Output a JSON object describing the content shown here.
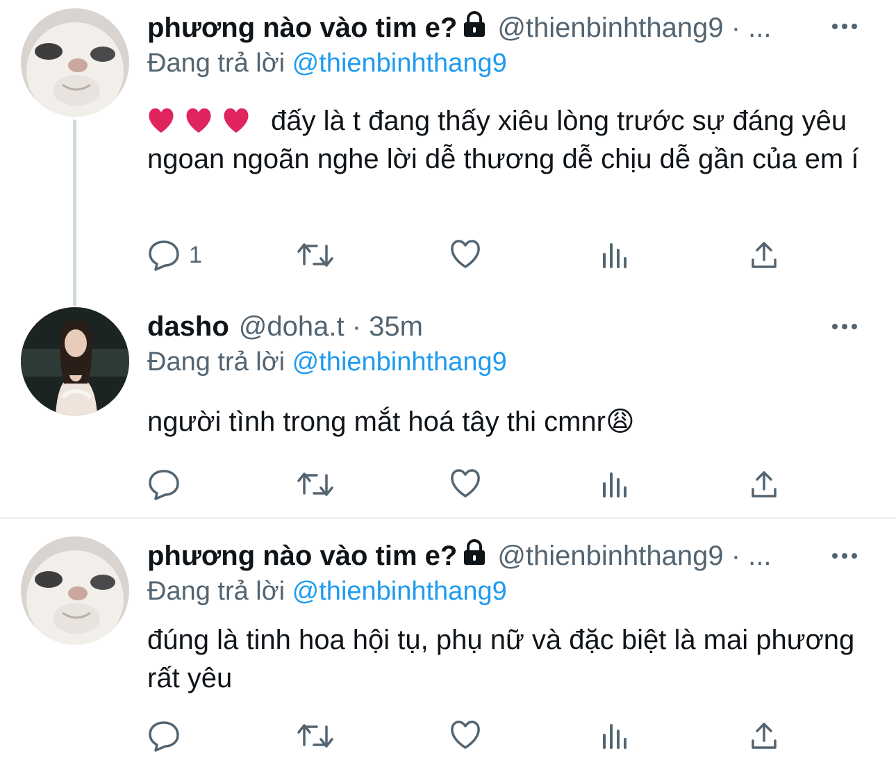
{
  "tweets": [
    {
      "name": "phương nào vào tim e?",
      "handle": "@thienbinhthang9 · ...",
      "replying_prefix": "Đang trả lời",
      "replying_to": "@thienbinhthang9",
      "text": "đấy là t đang thấy xiêu lòng trước sự đáng yêu ngoan ngoãn nghe lời dễ thương dễ chịu dễ gần của em í",
      "emoji_prefix": "❤️ ❤️ ❤️",
      "reply_count": "1",
      "locked": true
    },
    {
      "name": "dasho",
      "handle": "@doha.t · 35m",
      "replying_prefix": "Đang trả lời",
      "replying_to": "@thienbinhthang9",
      "text": "người tình trong mắt hoá tây thi cmnr😩",
      "reply_count": "",
      "locked": false
    },
    {
      "name": "phương nào vào tim e?",
      "handle": "@thienbinhthang9 · ...",
      "replying_prefix": "Đang trả lời",
      "replying_to": "@thienbinhthang9",
      "text": "đúng là tinh hoa hội tụ, phụ nữ và đặc biệt là mai phương rất yêu",
      "reply_count": "",
      "locked": true
    }
  ],
  "icons": {
    "reply": "reply-icon",
    "retweet": "retweet-icon",
    "like": "like-icon",
    "views": "views-icon",
    "share": "share-icon",
    "more": "more-icon",
    "lock": "lock-icon"
  },
  "colors": {
    "link": "#1d9bf0",
    "secondary_text": "#536471",
    "primary_text": "#0f1419",
    "heart": "#e0245e"
  }
}
